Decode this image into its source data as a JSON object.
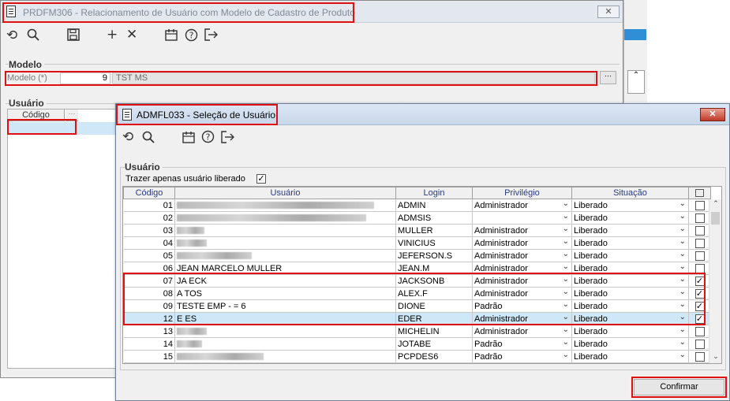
{
  "bg_window": {
    "title": "PRDFM306 - Relacionamento de Usuário com Modelo de Cadastro de Produto",
    "close_label": "✕",
    "modelo_group": "Modelo",
    "modelo_label": "Modelo (*)",
    "modelo_code": "9",
    "modelo_name": "TST MS",
    "usuario_group": "Usuário",
    "codigo_header": "Código"
  },
  "dialog": {
    "title": "ADMFL033 - Seleção de Usuário",
    "close_label": "✕",
    "group": "Usuário",
    "filter_label": "Trazer apenas usuário liberado",
    "filter_checked": true,
    "columns": [
      "Código",
      "Usuário",
      "Login",
      "Privilégio",
      "Situação"
    ],
    "rows": [
      {
        "code": "01",
        "name": "",
        "login": "ADMIN",
        "privilege": "Administrador",
        "status": "Liberado",
        "checked": false
      },
      {
        "code": "02",
        "name": "",
        "login": "ADMSIS",
        "privilege": "",
        "status": "Liberado",
        "checked": false
      },
      {
        "code": "03",
        "name": "",
        "login": "MULLER",
        "privilege": "Administrador",
        "status": "Liberado",
        "checked": false
      },
      {
        "code": "04",
        "name": "",
        "login": "VINICIUS",
        "privilege": "Administrador",
        "status": "Liberado",
        "checked": false
      },
      {
        "code": "05",
        "name": "",
        "login": "JEFERSON.S",
        "privilege": "Administrador",
        "status": "Liberado",
        "checked": false
      },
      {
        "code": "06",
        "name": "JEAN MARCELO MULLER",
        "login": "JEAN.M",
        "privilege": "Administrador",
        "status": "Liberado",
        "checked": false
      },
      {
        "code": "07",
        "name": "JA ECK",
        "login": "JACKSONB",
        "privilege": "Administrador",
        "status": "Liberado",
        "checked": true
      },
      {
        "code": "08",
        "name": "A TOS",
        "login": "ALEX.F",
        "privilege": "Administrador",
        "status": "Liberado",
        "checked": true
      },
      {
        "code": "09",
        "name": "TESTE EMP - = 6",
        "login": "DIONE",
        "privilege": "Padrão",
        "status": "Liberado",
        "checked": true
      },
      {
        "code": "12",
        "name": "E ES",
        "login": "EDER",
        "privilege": "Administrador",
        "status": "Liberado",
        "checked": true
      },
      {
        "code": "13",
        "name": "",
        "login": "MICHELIN",
        "privilege": "Administrador",
        "status": "Liberado",
        "checked": false
      },
      {
        "code": "14",
        "name": "",
        "login": "JOTABE",
        "privilege": "Padrão",
        "status": "Liberado",
        "checked": false
      },
      {
        "code": "15",
        "name": "",
        "login": "PCPDES6",
        "privilege": "Padrão",
        "status": "Liberado",
        "checked": false
      }
    ],
    "confirm_label": "Confirmar"
  },
  "colors": {
    "highlight": "#e01010",
    "selected_row": "#cfe8f7",
    "header_text": "#2a3a80"
  }
}
